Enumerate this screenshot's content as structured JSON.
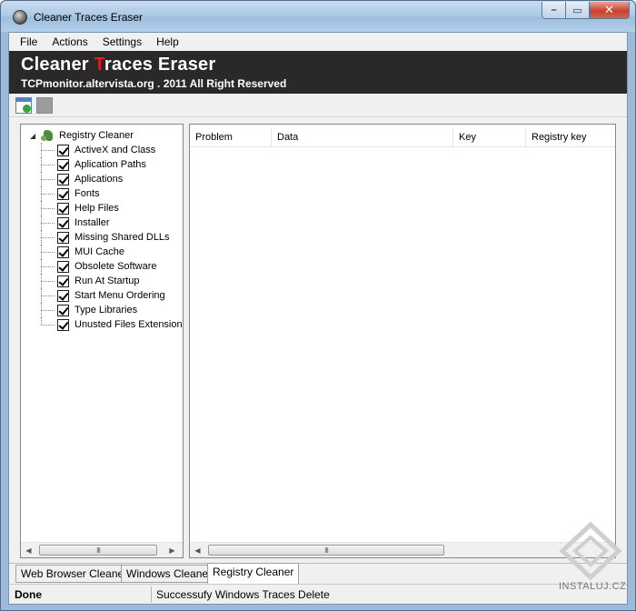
{
  "window": {
    "title": "Cleaner Traces Eraser"
  },
  "menu": {
    "file": "File",
    "actions": "Actions",
    "settings": "Settings",
    "help": "Help"
  },
  "banner": {
    "title_pre": "Cleaner ",
    "title_accent": "T",
    "title_post": "races Eraser",
    "subtitle": "TCPmonitor.altervista.org . 2011 All Right Reserved",
    "accent_color": "#e21f17"
  },
  "tree": {
    "root": "Registry Cleaner",
    "items": [
      {
        "label": "ActiveX and Class",
        "checked": true
      },
      {
        "label": "Aplication Paths",
        "checked": true
      },
      {
        "label": "Aplications",
        "checked": true
      },
      {
        "label": "Fonts",
        "checked": true
      },
      {
        "label": "Help Files",
        "checked": true
      },
      {
        "label": "Installer",
        "checked": true
      },
      {
        "label": "Missing Shared DLLs",
        "checked": true
      },
      {
        "label": "MUI Cache",
        "checked": true
      },
      {
        "label": "Obsolete Software",
        "checked": true
      },
      {
        "label": "Run At Startup",
        "checked": true
      },
      {
        "label": "Start Menu Ordering",
        "checked": true
      },
      {
        "label": "Type Libraries",
        "checked": true
      },
      {
        "label": "Unusted Files Extension",
        "checked": true
      }
    ]
  },
  "list": {
    "columns": [
      "Problem",
      "Data",
      "Key",
      "Registry key"
    ]
  },
  "scroll_grip": "III",
  "tabs": [
    "Web Browser Cleaner",
    "Windows Cleaner",
    "Registry Cleaner"
  ],
  "status": {
    "left": "Done",
    "right": "Successufy Windows Traces Delete"
  },
  "watermark": "INSTALUJ.CZ"
}
